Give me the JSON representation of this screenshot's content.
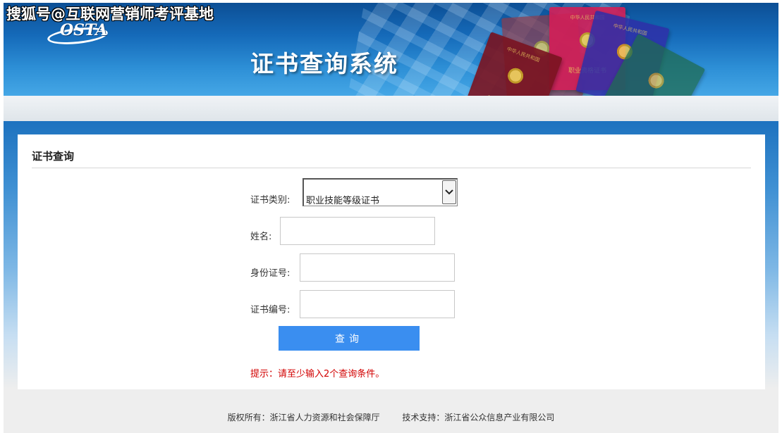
{
  "watermark": "搜狐号@互联网营销师考评基地",
  "header": {
    "logo_text": "OSTA",
    "system_title": "证书查询系统"
  },
  "books": {
    "emblem_label": "中华人民共和国",
    "cover_label": "职业资格证书"
  },
  "card": {
    "heading": "证书查询"
  },
  "form": {
    "cert_type_label": "证书类别:",
    "cert_type_value": "职业技能等级证书",
    "name_label": "姓名:",
    "name_value": "",
    "id_label": "身份证号:",
    "id_value": "",
    "cert_no_label": "证书编号:",
    "cert_no_value": "",
    "submit_label": "查询",
    "tip": "提示：请至少输入2个查询条件。"
  },
  "footer": {
    "copyright": "版权所有：浙江省人力资源和社会保障厅",
    "support": "技术支持：浙江省公众信息产业有限公司"
  },
  "colors": {
    "banner_blue": "#156ab9",
    "button_blue": "#3a8ef0",
    "tip_red": "#d20000"
  }
}
